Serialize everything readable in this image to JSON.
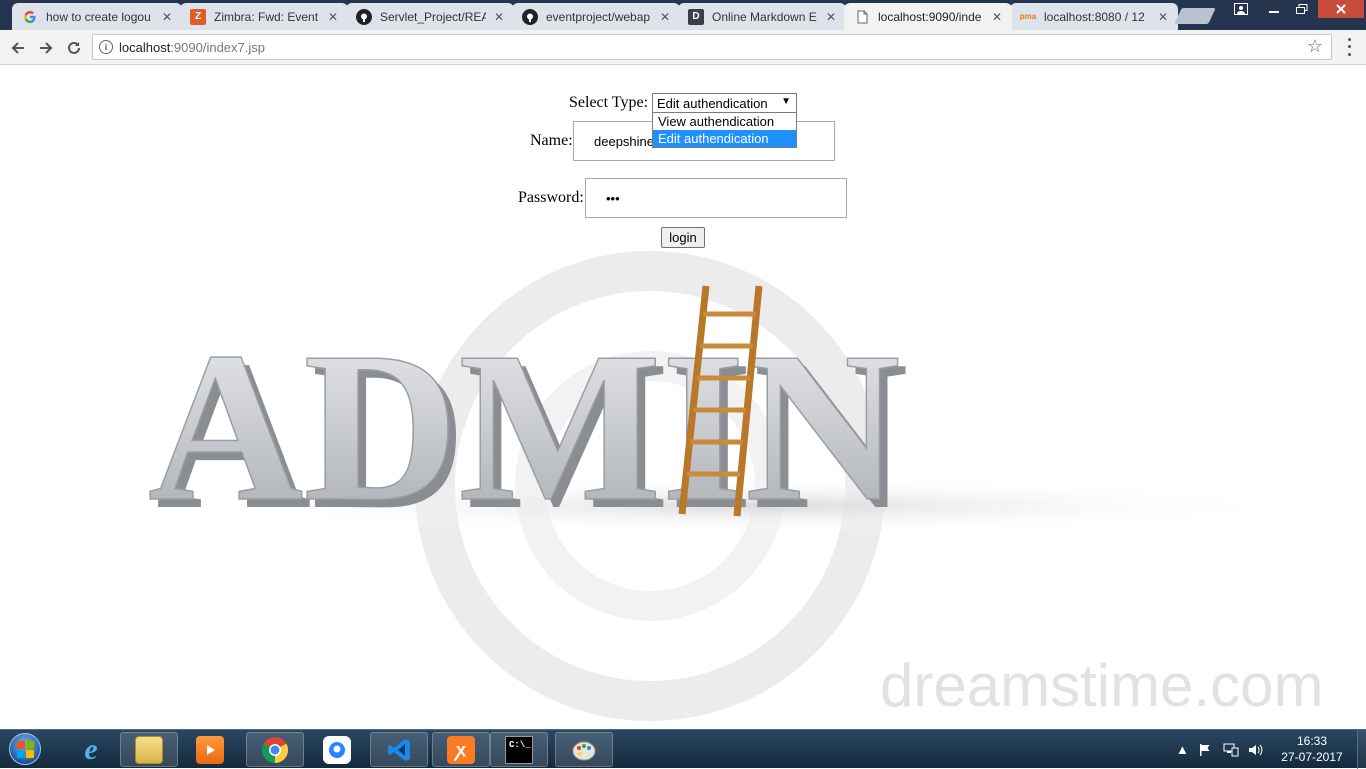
{
  "browser": {
    "tabs": [
      {
        "title": "how to create logou",
        "favicon": "google-icon"
      },
      {
        "title": "Zimbra: Fwd: Event",
        "favicon": "zimbra-icon"
      },
      {
        "title": "Servlet_Project/REA",
        "favicon": "github-icon"
      },
      {
        "title": "eventproject/webap",
        "favicon": "github-icon"
      },
      {
        "title": "Online Markdown E",
        "favicon": "dillinger-icon"
      },
      {
        "title": "localhost:9090/inde",
        "favicon": "document-icon",
        "active": true
      },
      {
        "title": "localhost:8080 / 12",
        "favicon": "phpmyadmin-icon"
      }
    ],
    "address": {
      "host": "localhost",
      "path": ":9090/index7.jsp"
    }
  },
  "form": {
    "select_type_label": "Select Type:",
    "select_value": "Edit authendication",
    "options": [
      "View authendication",
      "Edit authendication"
    ],
    "name_label": "Name:",
    "name_value": "deepshine",
    "password_label": "Password:",
    "password_mask": "•••",
    "login_label": "login"
  },
  "background": {
    "word": "ADMIN",
    "watermark": "dreamstime.com"
  },
  "taskbar": {
    "apps": [
      "internet-explorer-icon",
      "file-explorer-icon",
      "media-player-icon",
      "chrome-icon",
      "sourcetree-icon",
      "visual-studio-code-icon",
      "xampp-icon",
      "command-prompt-icon",
      "paint-icon"
    ],
    "time": "16:33",
    "date": "27-07-2017"
  },
  "colors": {
    "tabstrip": "#253550",
    "dropdown_selected": "#1e90ff",
    "taskbar": "#1c3550"
  }
}
